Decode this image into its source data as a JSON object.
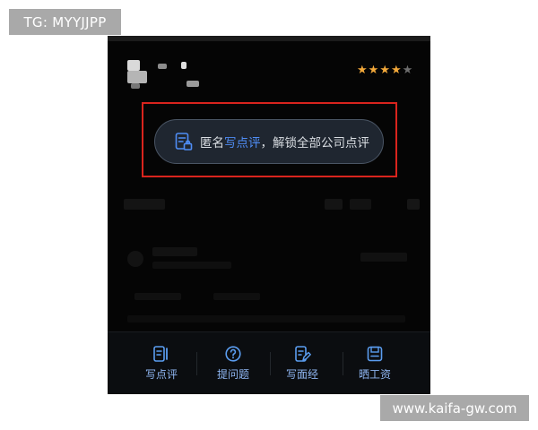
{
  "watermark": {
    "tag": "TG: MYYJJPP",
    "site": "www.kaifa-gw.com"
  },
  "rating": {
    "stars_filled": 4,
    "stars_total": 5
  },
  "colors": {
    "star_filled": "#f3a93a",
    "star_empty": "#6e6e6e",
    "accent": "#4f8df5",
    "highlight_frame": "#d9241d",
    "tab_label": "#8fb6f2"
  },
  "banner": {
    "icon": "review-lock-icon",
    "prefix": "匿名",
    "highlight": "写点评",
    "suffix": "，解锁全部公司点评"
  },
  "bottom_tabs": [
    {
      "label": "写点评",
      "icon": "write-review-icon"
    },
    {
      "label": "提问题",
      "icon": "question-icon"
    },
    {
      "label": "写面经",
      "icon": "write-interview-icon"
    },
    {
      "label": "晒工资",
      "icon": "salary-icon"
    }
  ]
}
